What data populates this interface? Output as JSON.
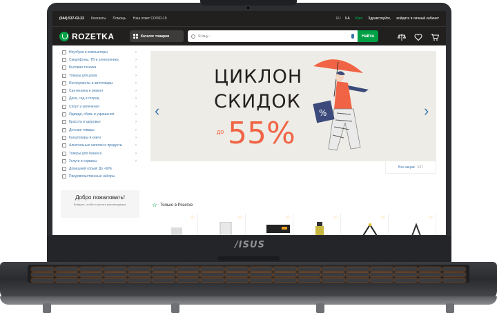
{
  "laptop": {
    "brand": "/ISUS"
  },
  "topbar": {
    "phone": "(044) 537-02-22",
    "links": [
      "Контакты",
      "Помощь",
      "Наш ответ COVID-19"
    ],
    "languages": [
      "RU",
      "UA"
    ],
    "city_label": "Kiev",
    "greeting": "Здравствуйте,",
    "login": "войдите в личный кабинет"
  },
  "header": {
    "logo": "ROZETKA",
    "catalog_button": "Каталог товаров",
    "search_placeholder": "Я ищу...",
    "search_button": "Найти",
    "icons": [
      "scales-icon",
      "heart-icon",
      "cart-icon"
    ]
  },
  "sidebar": {
    "categories": [
      {
        "label": "Ноутбуки и компьютеры",
        "chevron": true
      },
      {
        "label": "Смартфоны, ТВ и электроника",
        "chevron": true
      },
      {
        "label": "Бытовая техника",
        "chevron": true
      },
      {
        "label": "Товары для дома",
        "chevron": true
      },
      {
        "label": "Инструменты и автотовары",
        "chevron": true
      },
      {
        "label": "Сантехника и ремонт",
        "chevron": true
      },
      {
        "label": "Дача, сад и огород",
        "chevron": true
      },
      {
        "label": "Спорт и увлечения",
        "chevron": true
      },
      {
        "label": "Одежда, обувь и украшения",
        "chevron": true
      },
      {
        "label": "Красота и здоровье",
        "chevron": true
      },
      {
        "label": "Детские товары",
        "chevron": true
      },
      {
        "label": "Канцтовары и книги",
        "chevron": true
      },
      {
        "label": "Алкогольные напитки и продукты",
        "chevron": true
      },
      {
        "label": "Товары для бизнеса",
        "chevron": true
      },
      {
        "label": "Услуги и сервисы",
        "chevron": true
      },
      {
        "label": "Домашний отрыв! До -60%",
        "chevron": false
      },
      {
        "label": "Продовольственные наборы",
        "chevron": false
      }
    ],
    "welcome_title": "Добро пожаловать!",
    "welcome_sub": "Войдите, чтобы получать рекомендации,"
  },
  "banner": {
    "line1": "ЦИКЛОН",
    "line2": "СКИДОК",
    "prefix": "до",
    "percent": "55%"
  },
  "promos": {
    "label": "Все акции",
    "count": "637"
  },
  "section": {
    "title": "Только в Розетке"
  },
  "colors": {
    "brand_green": "#00a046",
    "dark": "#221f1f",
    "link": "#3e77aa",
    "accent": "#f06445",
    "heart": "#f8a01c"
  }
}
